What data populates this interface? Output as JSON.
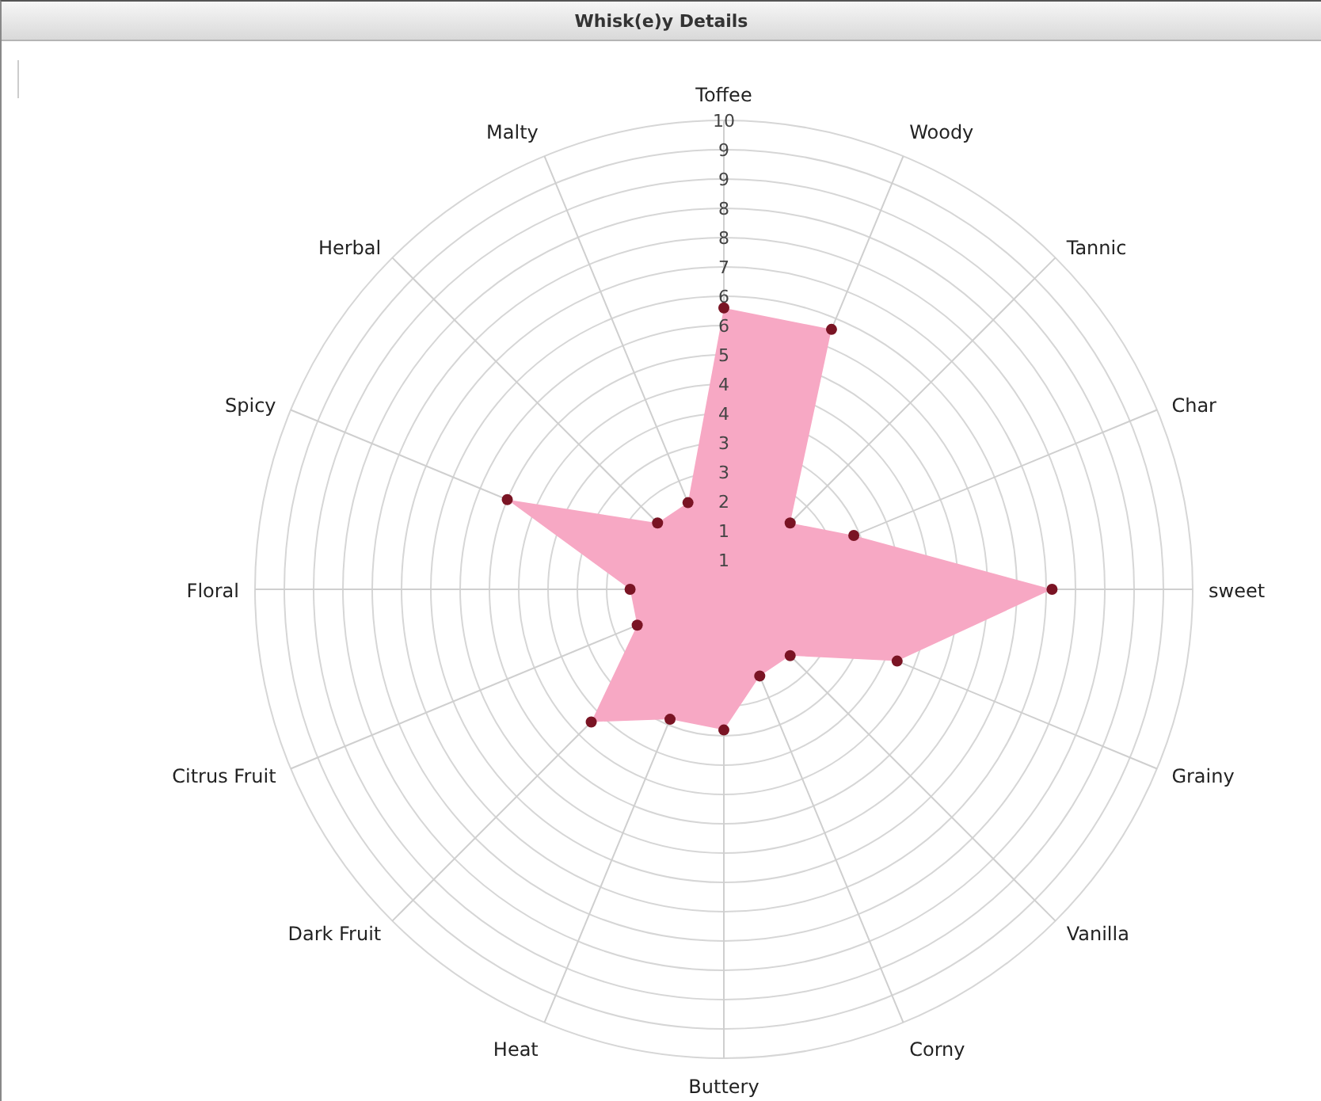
{
  "window": {
    "title": "Whisk(e)y Details"
  },
  "chart": {
    "chart_data": {
      "type": "radar",
      "categories": [
        "Toffee",
        "Woody",
        "Tannic",
        "Char",
        "sweet",
        "Grainy",
        "Vanilla",
        "Corny",
        "Buttery",
        "Heat",
        "Dark Fruit",
        "Citrus Fruit",
        "Floral",
        "Spicy",
        "Herbal",
        "Malty"
      ],
      "series": [
        {
          "color": "#f7a8c4",
          "values": [
            6,
            6,
            2,
            3,
            7,
            4,
            2,
            2,
            3,
            3,
            4,
            2,
            2,
            5,
            2,
            2
          ]
        }
      ],
      "ylim": [
        0,
        10
      ],
      "yticks": [
        {
          "value": 0.625,
          "label": "1"
        },
        {
          "value": 1.25,
          "label": "1"
        },
        {
          "value": 1.875,
          "label": "2"
        },
        {
          "value": 2.5,
          "label": "3"
        },
        {
          "value": 3.125,
          "label": "3"
        },
        {
          "value": 3.75,
          "label": "4"
        },
        {
          "value": 4.375,
          "label": "4"
        },
        {
          "value": 5,
          "label": "5"
        },
        {
          "value": 5.625,
          "label": "6"
        },
        {
          "value": 6.25,
          "label": "6"
        },
        {
          "value": 6.875,
          "label": "7"
        },
        {
          "value": 7.5,
          "label": "8"
        },
        {
          "value": 8.125,
          "label": "8"
        },
        {
          "value": 8.75,
          "label": "9"
        },
        {
          "value": 9.375,
          "label": "9"
        },
        {
          "value": 10,
          "label": "10"
        }
      ]
    }
  }
}
